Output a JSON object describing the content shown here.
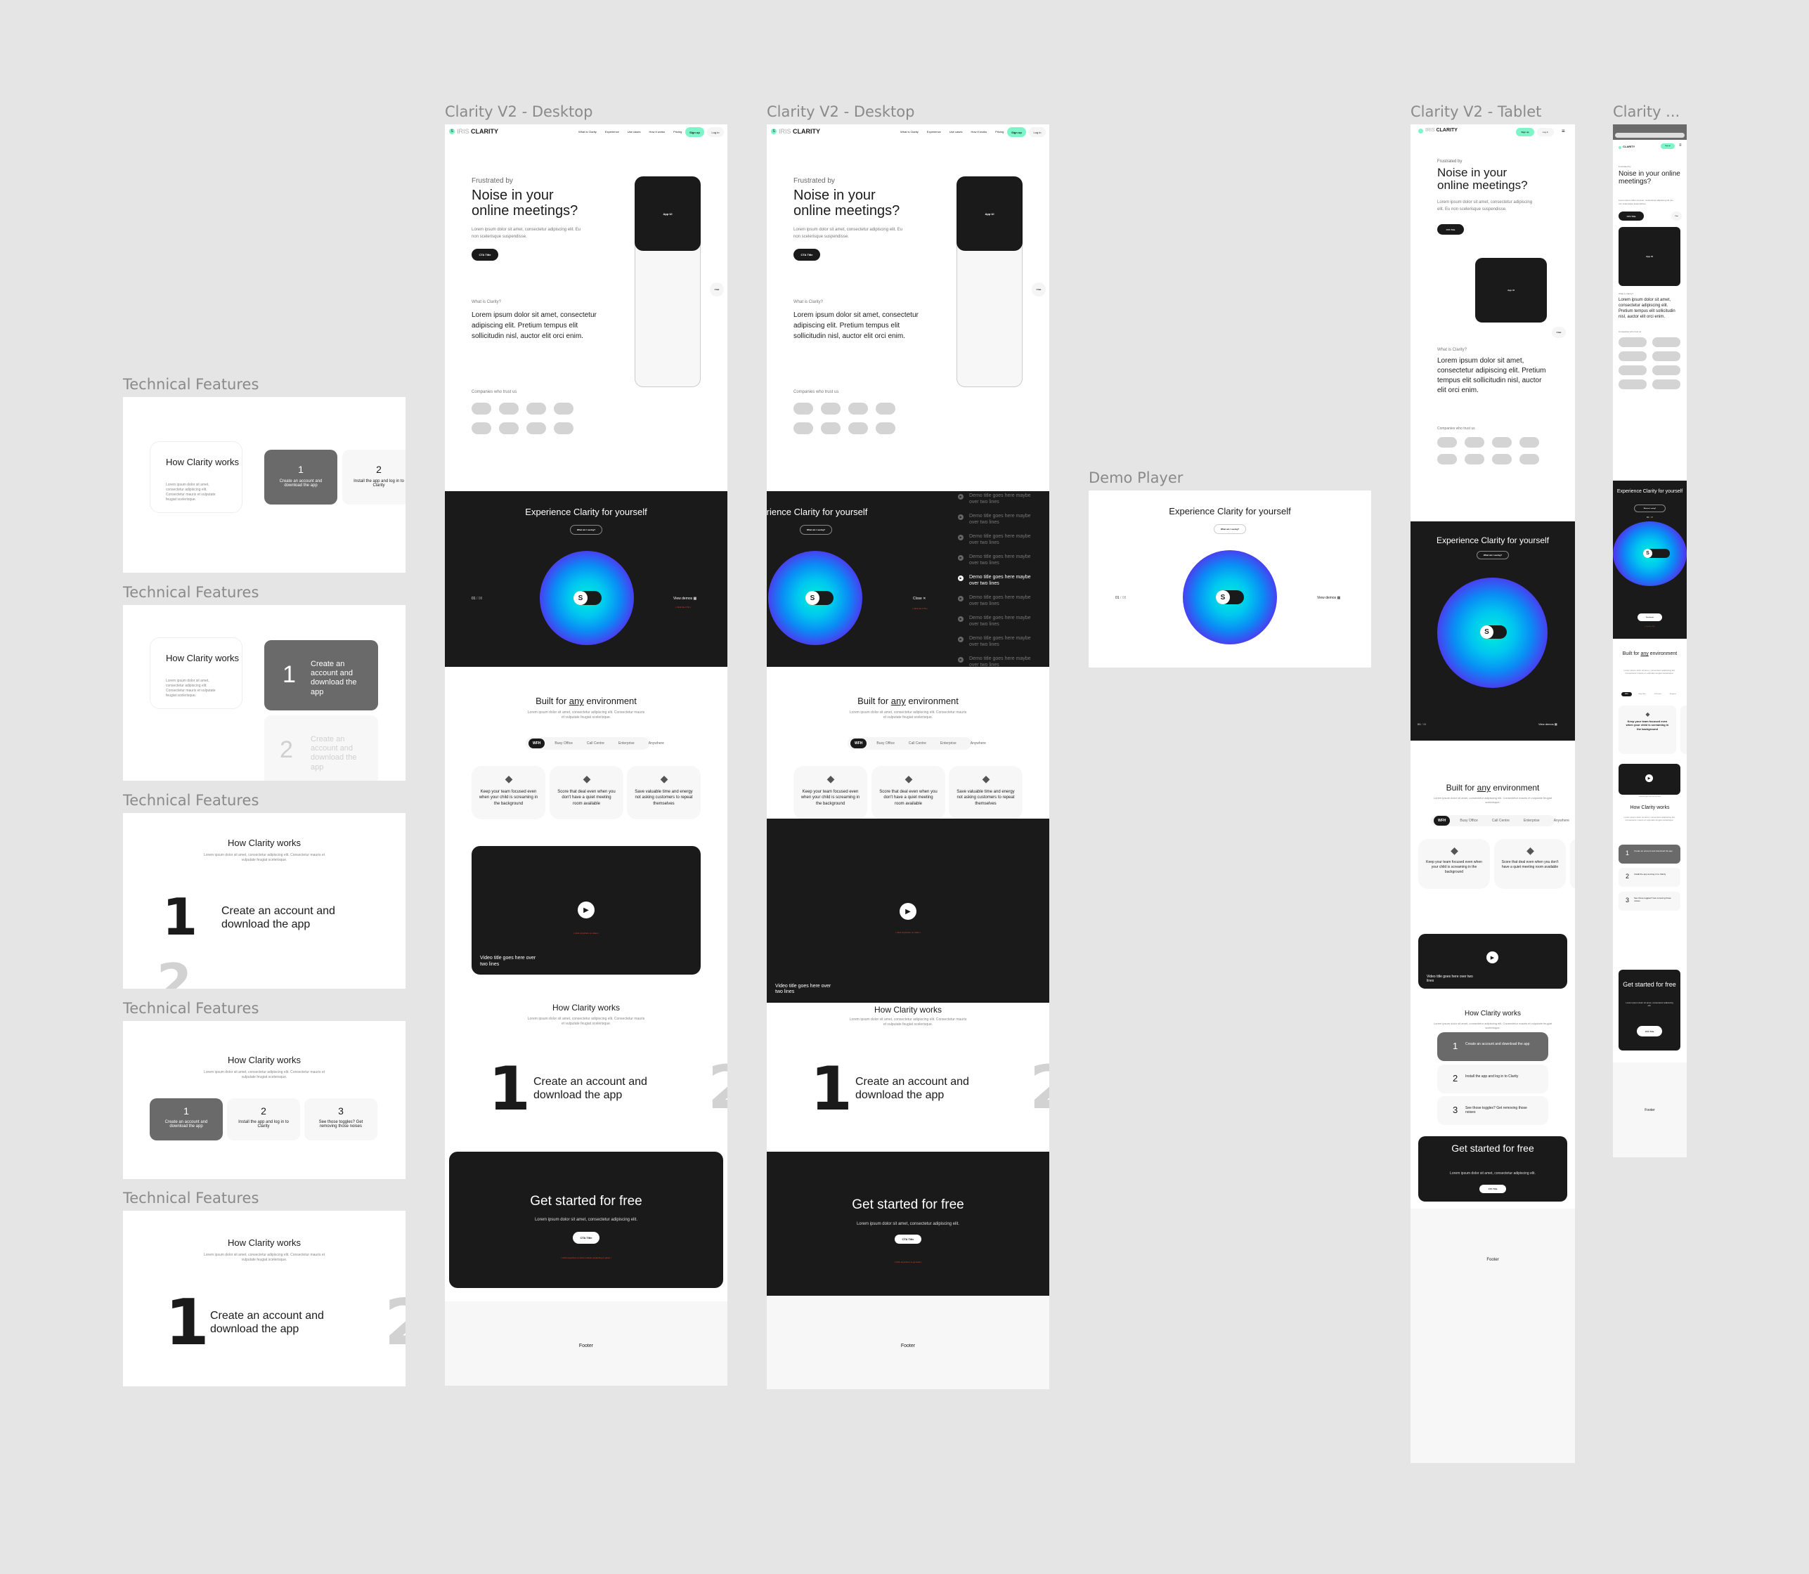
{
  "canvas": {
    "labels": {
      "tech_features": "Technical Features",
      "desktop_1": "Clarity V2 - Desktop",
      "desktop_2": "Clarity V2 - Desktop",
      "demo_player": "Demo Player",
      "tablet": "Clarity V2 - Tablet",
      "mobile": "Clarity ..."
    }
  },
  "brand": {
    "logo_prefix": "IRIS",
    "logo_name": "CLARITY",
    "accent": "#7ef5c8",
    "dark": "#1a1a1a",
    "annotation": "#d8452b"
  },
  "nav": {
    "items": [
      "What is Clarity",
      "Experience",
      "Use cases",
      "How it works",
      "Pricing"
    ],
    "signup": "Sign up",
    "login": "Log in",
    "menu_icon": "hamburger-icon"
  },
  "hero": {
    "eyebrow": "Frustrated by",
    "title_line1": "Noise in your",
    "title_line2": "online meetings?",
    "body": "Lorem ipsum dolor sit amet, consectetur adipiscing elit. Eu non scelerisque suspendisse.",
    "cta": "CTA Title",
    "app_ui": "App UI",
    "chat": "Chat"
  },
  "about": {
    "eyebrow": "What is Clarity?",
    "body": "Lorem ipsum dolor sit amet, consectetur adipiscing elit. Pretium tempus elit sollicitudin nisl, auctor elit orci enim.",
    "companies_label": "Companies who trust us"
  },
  "experience": {
    "title": "Experience Clarity for yourself",
    "what_button": "What am I seeing?",
    "counter_current": "01",
    "counter_sep": "/",
    "counter_total": "08",
    "view_demos": "View demos",
    "close": "Close",
    "annotation": "( Click the CTA )",
    "knob_glyph": "S",
    "demo_items": [
      {
        "title": "Demo title goes here maybe over two lines",
        "active": false
      },
      {
        "title": "Demo title goes here maybe over two lines",
        "active": false
      },
      {
        "title": "Demo title goes here maybe over two lines",
        "active": false
      },
      {
        "title": "Demo title goes here maybe over two lines",
        "active": false
      },
      {
        "title": "Demo title goes here maybe over two lines",
        "active": true
      },
      {
        "title": "Demo title goes here maybe over two lines",
        "active": false
      },
      {
        "title": "Demo title goes here maybe over two lines",
        "active": false
      },
      {
        "title": "Demo title goes here maybe over two lines",
        "active": false
      },
      {
        "title": "Demo title goes here maybe over two lines",
        "active": false
      }
    ]
  },
  "environment": {
    "title_pre": "Built for ",
    "title_em": "any",
    "title_post": " environment",
    "body": "Lorem ipsum dolor sit amet, consectetur adipiscing elit. Consectetur mauris et vulputate feugiat scelerisque.",
    "tabs": [
      "WFH",
      "Busy Office",
      "Call Centre",
      "Enterprise",
      "Anywhere"
    ],
    "active_tab": "WFH",
    "cards": [
      "Keep your team focused even when your child is screaming in the background",
      "Score that deal even when you don't have a quiet meeting room available",
      "Save valuable time and energy not asking customers to repeat themselves"
    ],
    "card_icon": "soundwave-icon"
  },
  "video": {
    "title": "Video title goes here over two lines",
    "annotation": "( Click anywhere on video )"
  },
  "how": {
    "title": "How Clarity works",
    "body": "Lorem ipsum dolor sit amet, consectetur adipiscing elit. Consectetur mauris et vulputate feugiat scelerisque.",
    "body_short": "Lorem ipsum dolor sit amet, consectetur adipiscing elit. Consectetur mauris et vulputate feugiat scelerisque.",
    "steps": [
      {
        "num": "1",
        "text": "Create an account and download the app"
      },
      {
        "num": "2",
        "text": "Install the app and log in to Clarity"
      },
      {
        "num": "3",
        "text": "See those toggles? Get removing those noises"
      }
    ]
  },
  "cta_section": {
    "title": "Get started for free",
    "body": "Lorem ipsum dolor sit amet, consectetur adipiscing elit.",
    "button": "CTA Title",
    "annotation_1": "( Click anywhere to show module expanding in place )",
    "annotation_2": "( Click anywhere to go back )"
  },
  "footer": {
    "label": "Footer"
  }
}
